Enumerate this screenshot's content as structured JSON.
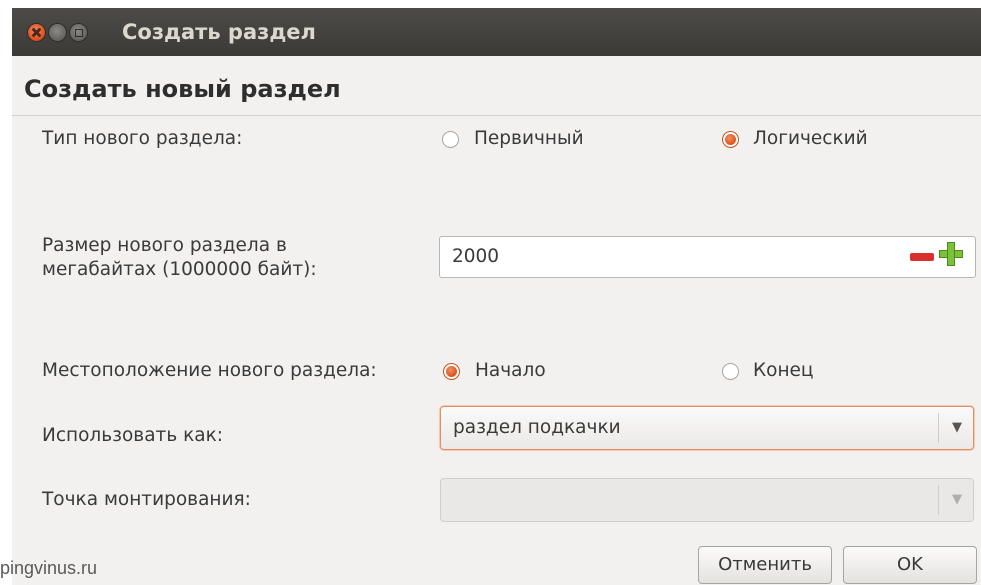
{
  "window": {
    "title": "Создать раздел",
    "heading": "Создать новый раздел"
  },
  "partition_type": {
    "label": "Тип нового раздела:",
    "options": [
      {
        "label": "Первичный",
        "selected": false
      },
      {
        "label": "Логический",
        "selected": true
      }
    ]
  },
  "size": {
    "label_line1": "Размер нового раздела в",
    "label_line2": "мегабайтах (1000000 байт):",
    "value": "2000",
    "decrement_icon": "minus-icon",
    "increment_icon": "plus-icon"
  },
  "location": {
    "label": "Местоположение нового раздела:",
    "options": [
      {
        "label": "Начало",
        "selected": true
      },
      {
        "label": "Конец",
        "selected": false
      }
    ]
  },
  "use_as": {
    "label": "Использовать как:",
    "value": "раздел подкачки"
  },
  "mount_point": {
    "label": "Точка монтирования:",
    "value": "",
    "enabled": false
  },
  "buttons": {
    "cancel": "Отменить",
    "ok": "OK"
  },
  "watermark": "pingvinus.ru",
  "colors": {
    "titlebar": "#3c3b37",
    "accent": "#e05a24",
    "background": "#f2f1f0"
  }
}
